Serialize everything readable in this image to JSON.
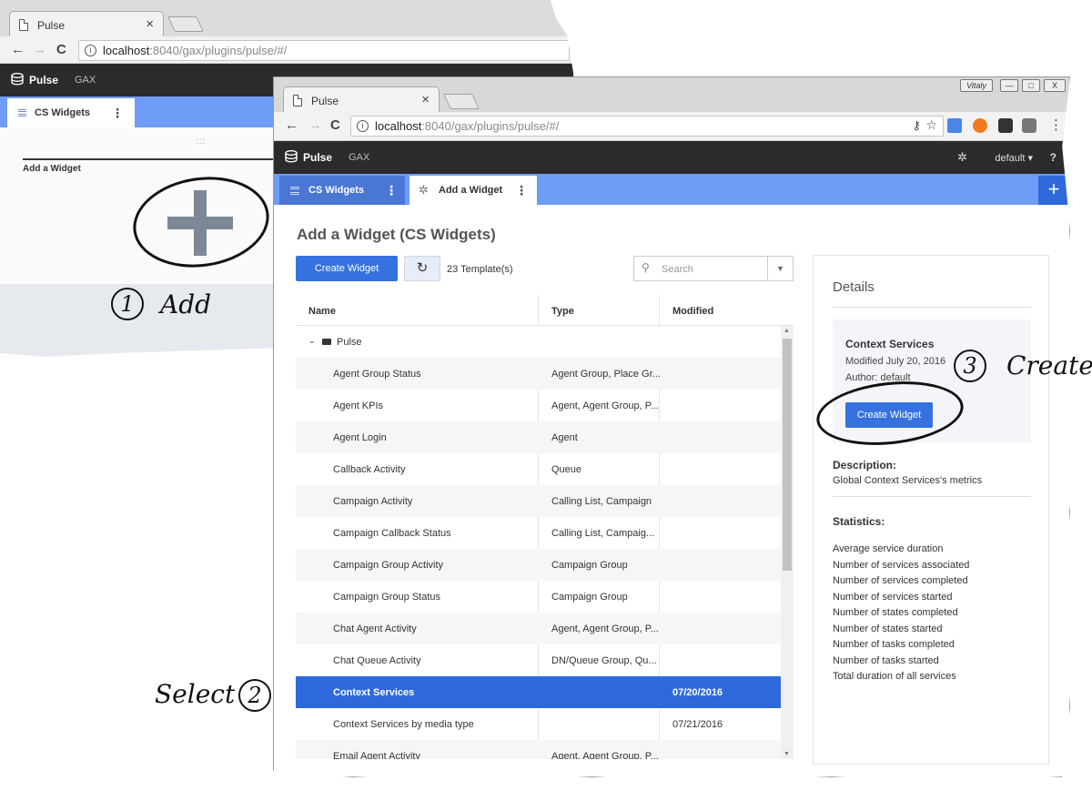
{
  "browser": {
    "tab_title": "Pulse",
    "tab_close": "×",
    "back": "←",
    "forward": "→",
    "reload": "C",
    "info": "i",
    "url_host": "localhost",
    "url_rest": ":8040/gax/plugins/pulse/#/",
    "user_badge": "Vitaly",
    "win_min": "—",
    "win_max": "□",
    "win_close": "X"
  },
  "app": {
    "brand": "Pulse",
    "nav_gax": "GAX",
    "user_menu": "default",
    "help": "?"
  },
  "background_window": {
    "tab_label": "CS Widgets",
    "dots": ":::",
    "canvas_label": "Add a Widget"
  },
  "tabs": [
    {
      "label": "CS Widgets",
      "active": false
    },
    {
      "label": "Add a Widget",
      "active": true
    }
  ],
  "page": {
    "title": "Add a Widget (CS Widgets)",
    "create_button": "Create Widget",
    "template_count": "23 Template(s)",
    "search_placeholder": "Search"
  },
  "table": {
    "columns": [
      "Name",
      "Type",
      "Modified"
    ],
    "folder": "Pulse",
    "rows": [
      {
        "name": "Agent Group Status",
        "type": "Agent Group, Place Gr...",
        "modified": ""
      },
      {
        "name": "Agent KPIs",
        "type": "Agent, Agent Group, P...",
        "modified": ""
      },
      {
        "name": "Agent Login",
        "type": "Agent",
        "modified": ""
      },
      {
        "name": "Callback Activity",
        "type": "Queue",
        "modified": ""
      },
      {
        "name": "Campaign Activity",
        "type": "Calling List, Campaign",
        "modified": ""
      },
      {
        "name": "Campaign Callback Status",
        "type": "Calling List, Campaig...",
        "modified": ""
      },
      {
        "name": "Campaign Group Activity",
        "type": "Campaign Group",
        "modified": ""
      },
      {
        "name": "Campaign Group Status",
        "type": "Campaign Group",
        "modified": ""
      },
      {
        "name": "Chat Agent Activity",
        "type": "Agent, Agent Group, P...",
        "modified": ""
      },
      {
        "name": "Chat Queue Activity",
        "type": "DN/Queue Group, Qu...",
        "modified": ""
      },
      {
        "name": "Context Services",
        "type": "",
        "modified": "07/20/2016",
        "selected": true
      },
      {
        "name": "Context Services by media type",
        "type": "",
        "modified": "07/21/2016"
      },
      {
        "name": "Email Agent Activity",
        "type": "Agent, Agent Group, P...",
        "modified": ""
      }
    ]
  },
  "details": {
    "heading": "Details",
    "name": "Context Services",
    "modified": "Modified July 20, 2016",
    "author": "Author: default",
    "create_button": "Create Widget",
    "description_label": "Description:",
    "description": "Global Context Services's metrics",
    "statistics_label": "Statistics:",
    "statistics": [
      "Average service duration",
      "Number of services associated",
      "Number of services completed",
      "Number of services started",
      "Number of states completed",
      "Number of states started",
      "Number of tasks completed",
      "Number of tasks started",
      "Total duration of all services"
    ]
  },
  "annotations": {
    "step1_num": "1",
    "step1_text": "Add",
    "step2_num": "2",
    "step2_text": "Select",
    "step3_num": "3",
    "step3_text": "Create"
  },
  "colors": {
    "app_bar": "#2b2b2b",
    "tab_bar": "#6e9cf6",
    "primary": "#3572e0",
    "selected_row": "#2e69db"
  }
}
